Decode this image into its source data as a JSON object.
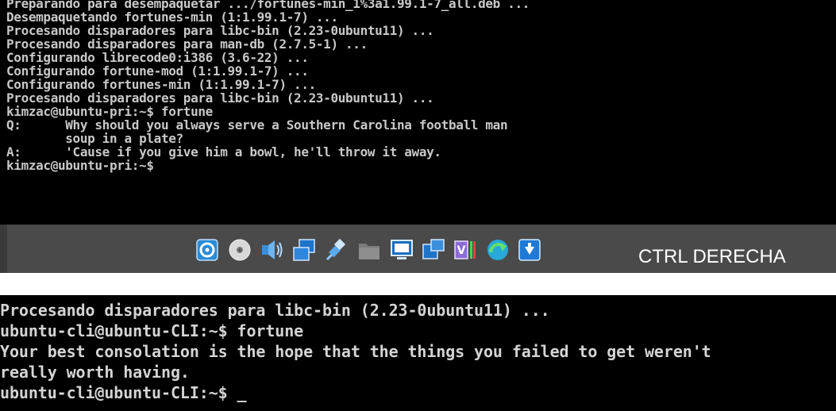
{
  "terminal_top": {
    "lines": [
      "Preparando para desempaquetar .../fortunes-min_1%3a1.99.1-7_all.deb ...",
      "Desempaquetando fortunes-min (1:1.99.1-7) ...",
      "Procesando disparadores para libc-bin (2.23-0ubuntu11) ...",
      "Procesando disparadores para man-db (2.7.5-1) ...",
      "Configurando librecode0:i386 (3.6-22) ...",
      "Configurando fortune-mod (1:1.99.1-7) ...",
      "Configurando fortunes-min (1:1.99.1-7) ...",
      "Procesando disparadores para libc-bin (2.23-0ubuntu11) ...",
      "kimzac@ubuntu-pri:~$ fortune",
      "Q:      Why should you always serve a Southern Carolina football man",
      "        soup in a plate?",
      "A:      'Cause if you give him a bowl, he'll throw it away.",
      "kimzac@ubuntu-pri:~$"
    ]
  },
  "statusbar": {
    "host_key_label": "CTRL DERECHA",
    "icons": [
      "hard-disk-icon",
      "optical-drive-icon",
      "audio-icon",
      "network-icon",
      "usb-icon",
      "shared-folder-icon",
      "display-icon",
      "recording-icon",
      "cpu-icon",
      "mouse-integration-icon",
      "keyboard-capture-icon"
    ]
  },
  "terminal_bottom": {
    "lines": [
      "Procesando disparadores para libc-bin (2.23-0ubuntu11) ...",
      "ubuntu-cli@ubuntu-CLI:~$ fortune",
      "Your best consolation is the hope that the things you failed to get weren't",
      "really worth having.",
      "ubuntu-cli@ubuntu-CLI:~$ _"
    ]
  }
}
